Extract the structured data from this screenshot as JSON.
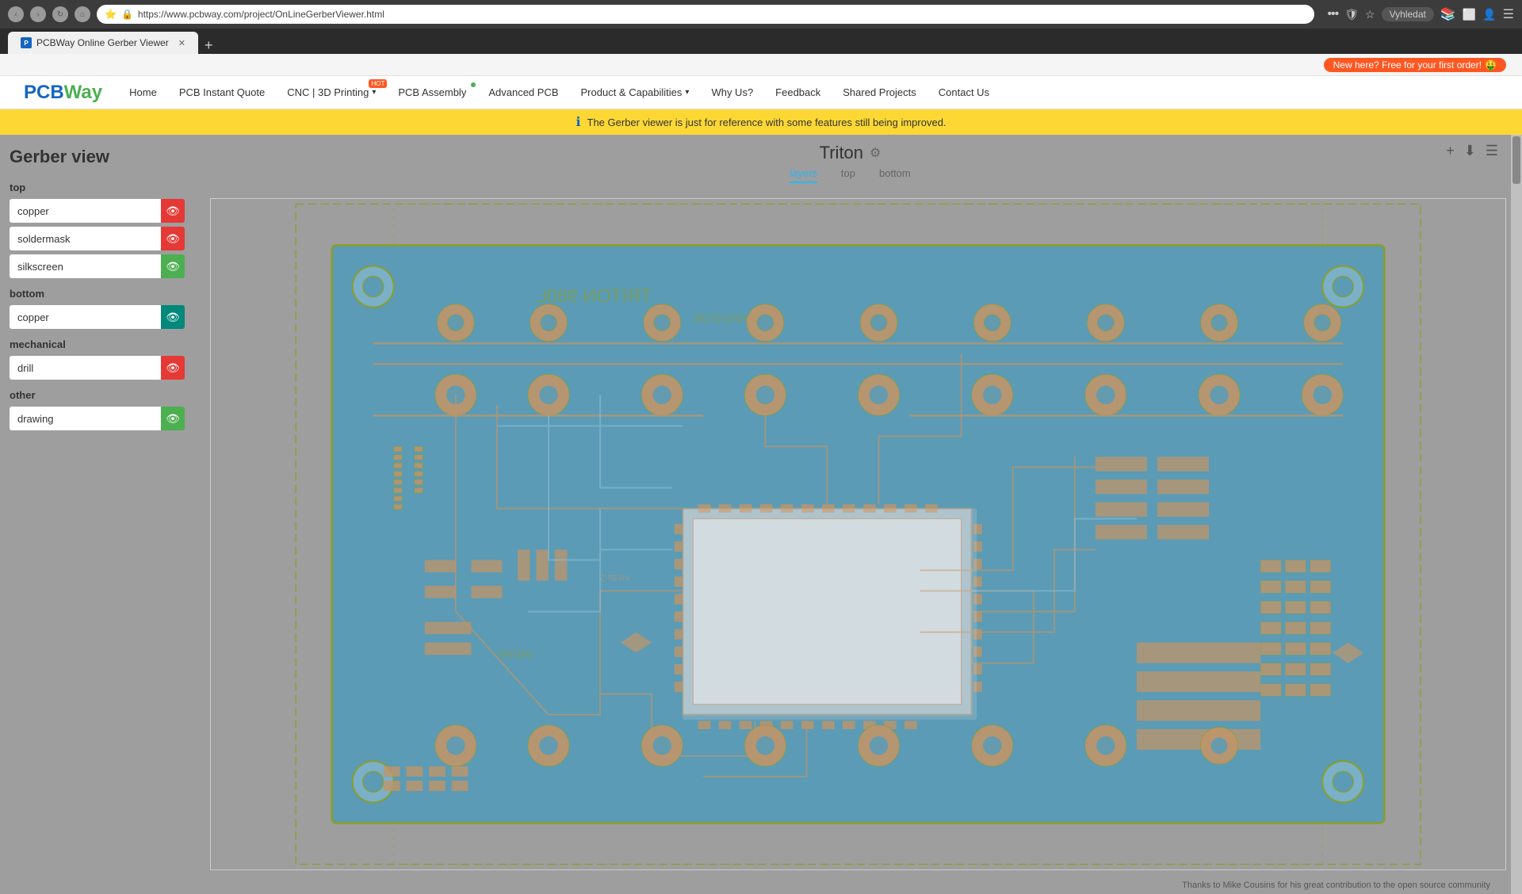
{
  "browser": {
    "url": "https://www.pcbway.com/project/OnLineGerberViewer.html",
    "tab_title": "PCBWay Online Gerber Viewer"
  },
  "promo": {
    "text": "New here? Free for your first order!",
    "icon": "$"
  },
  "nav": {
    "logo": "PCBWay",
    "links": [
      {
        "id": "home",
        "label": "Home",
        "badge": null
      },
      {
        "id": "instant-quote",
        "label": "PCB Instant Quote",
        "badge": null
      },
      {
        "id": "cnc-3d",
        "label": "CNC | 3D Printing",
        "badge": "HOT",
        "has_arrow": true
      },
      {
        "id": "pcb-assembly",
        "label": "PCB Assembly",
        "badge": null,
        "dot": true
      },
      {
        "id": "advanced-pcb",
        "label": "Advanced PCB",
        "badge": null
      },
      {
        "id": "product-capabilities",
        "label": "Product & Capabilities",
        "badge": null,
        "has_arrow": true
      },
      {
        "id": "why-us",
        "label": "Why Us?",
        "badge": null
      },
      {
        "id": "feedback",
        "label": "Feedback",
        "badge": null
      },
      {
        "id": "shared-projects",
        "label": "Shared Projects",
        "badge": null
      },
      {
        "id": "contact-us",
        "label": "Contact Us",
        "badge": null
      }
    ]
  },
  "info_banner": {
    "text": "The Gerber viewer is just for reference with some features still being improved."
  },
  "left_panel": {
    "title_prefix": "Gerber ",
    "title_main": "view",
    "sections": [
      {
        "id": "top",
        "title": "top",
        "layers": [
          {
            "id": "top-copper",
            "name": "copper",
            "toggle_color": "red",
            "visible": true
          },
          {
            "id": "top-soldermask",
            "name": "soldermask",
            "toggle_color": "red",
            "visible": true
          },
          {
            "id": "top-silkscreen",
            "name": "silkscreen",
            "toggle_color": "green",
            "visible": true
          }
        ]
      },
      {
        "id": "bottom",
        "title": "bottom",
        "layers": [
          {
            "id": "bottom-copper",
            "name": "copper",
            "toggle_color": "teal",
            "visible": true
          }
        ]
      },
      {
        "id": "mechanical",
        "title": "mechanical",
        "layers": [
          {
            "id": "mech-drill",
            "name": "drill",
            "toggle_color": "red",
            "visible": true
          }
        ]
      },
      {
        "id": "other",
        "title": "other",
        "layers": [
          {
            "id": "other-drawing",
            "name": "drawing",
            "toggle_color": "green",
            "visible": true
          }
        ]
      }
    ]
  },
  "gerber_viewer": {
    "title": "Triton",
    "tabs": [
      {
        "id": "layers",
        "label": "layers",
        "active": true
      },
      {
        "id": "top",
        "label": "top",
        "active": false
      },
      {
        "id": "bottom",
        "label": "bottom",
        "active": false
      }
    ],
    "footer_credit": "Thanks to Mike Cousins for his great contribution to the open source community"
  },
  "icons": {
    "eye": "👁",
    "gear": "⚙",
    "plus": "+",
    "download": "⬇",
    "menu": "☰",
    "info": "ℹ",
    "security": "🔒",
    "back": "‹",
    "forward": "›",
    "refresh": "↻",
    "home": "⌂",
    "more": "•••",
    "bookmark": "★",
    "extensions": "📚",
    "window": "⬜",
    "profile": "👤",
    "hamburger": "☰"
  }
}
